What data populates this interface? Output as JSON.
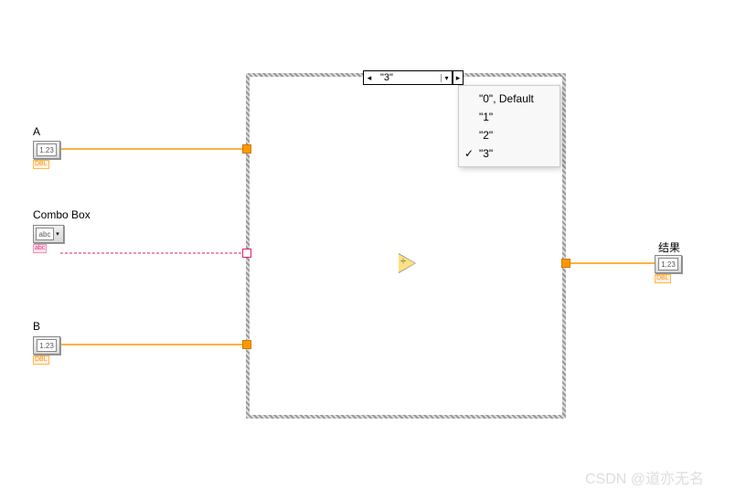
{
  "controls": {
    "a": {
      "label": "A",
      "terminal_text": "1.23",
      "type": "DBL"
    },
    "b": {
      "label": "B",
      "terminal_text": "1.23",
      "type": "DBL"
    },
    "combo": {
      "label": "Combo Box",
      "terminal_text": "abc",
      "type": "abc"
    }
  },
  "indicators": {
    "result": {
      "label": "结果",
      "terminal_text": "1.23",
      "type": "DBL"
    }
  },
  "case_structure": {
    "selector_value": "\"3\"",
    "dropdown": [
      {
        "label": "\"0\", Default",
        "checked": false
      },
      {
        "label": "\"1\"",
        "checked": false
      },
      {
        "label": "\"2\"",
        "checked": false
      },
      {
        "label": "\"3\"",
        "checked": true
      }
    ]
  },
  "operation": {
    "node": "divide"
  },
  "watermark": "CSDN @道亦无名"
}
